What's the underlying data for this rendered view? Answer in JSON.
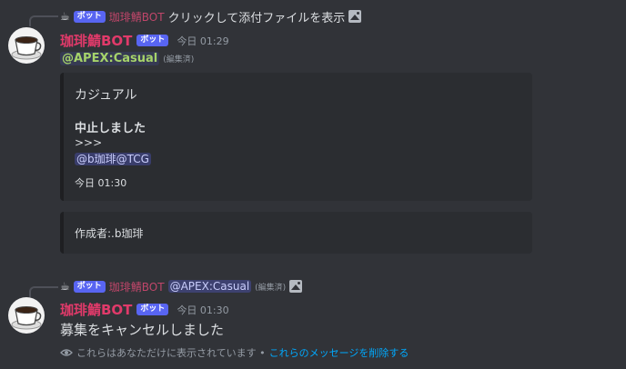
{
  "message1": {
    "reply": {
      "author": "珈琲鯖BOT",
      "bot_badge": "ボット",
      "text": "クリックして添付ファイルを表示"
    },
    "author": "珈琲鯖BOT",
    "bot_badge": "ボット",
    "timestamp": "今日 01:29",
    "mention": "@APEX:Casual",
    "edited": "(編集済)",
    "embed1": {
      "title": "カジュアル",
      "status": "中止しました",
      "arrows": ">>>",
      "mention": "@b珈琲@TCG",
      "time": "今日 01:30"
    },
    "embed2": {
      "creator": "作成者:.b珈琲"
    }
  },
  "message2": {
    "reply": {
      "author": "珈琲鯖BOT",
      "bot_badge": "ボット",
      "mention": "@APEX:Casual",
      "edited": "(編集済)"
    },
    "author": "珈琲鯖BOT",
    "bot_badge": "ボット",
    "timestamp": "今日 01:30",
    "content": "募集をキャンセルしました",
    "ephemeral": {
      "text": "これらはあなただけに表示されています •",
      "delete_link": "これらのメッセージを削除する"
    }
  },
  "icons": {
    "avatar": "coffee-cup-icon",
    "attachment": "image-icon",
    "ephemeral": "eye-icon"
  },
  "colors": {
    "background": "#313338",
    "author": "#e13a6a",
    "bot_badge": "#5865f2",
    "link": "#00a8fc"
  }
}
